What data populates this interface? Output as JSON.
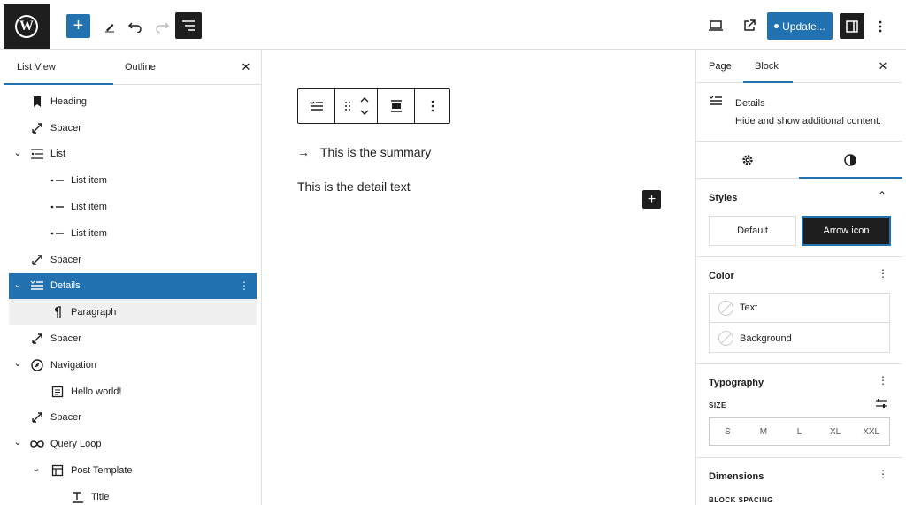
{
  "topbar": {
    "logo_letter": "W",
    "update_label": "Update..."
  },
  "left_panel": {
    "tabs": [
      "List View",
      "Outline"
    ],
    "items": [
      {
        "label": "Heading",
        "icon": "bookmark-icon",
        "chevron": false,
        "level": 1,
        "state": "normal"
      },
      {
        "label": "Spacer",
        "icon": "resize-arrow-icon",
        "chevron": false,
        "level": 1,
        "state": "normal"
      },
      {
        "label": "List",
        "icon": "list-icon",
        "chevron": true,
        "level": 1,
        "state": "normal"
      },
      {
        "label": "List item",
        "icon": "list-item-icon",
        "chevron": false,
        "level": 2,
        "state": "normal"
      },
      {
        "label": "List item",
        "icon": "list-item-icon",
        "chevron": false,
        "level": 2,
        "state": "normal"
      },
      {
        "label": "List item",
        "icon": "list-item-icon",
        "chevron": false,
        "level": 2,
        "state": "normal"
      },
      {
        "label": "Spacer",
        "icon": "resize-arrow-icon",
        "chevron": false,
        "level": 1,
        "state": "normal"
      },
      {
        "label": "Details",
        "icon": "details-icon",
        "chevron": true,
        "level": 1,
        "state": "selected"
      },
      {
        "label": "Paragraph",
        "icon": "pilcrow-icon",
        "chevron": false,
        "level": 2,
        "state": "child"
      },
      {
        "label": "Spacer",
        "icon": "resize-arrow-icon",
        "chevron": false,
        "level": 1,
        "state": "normal"
      },
      {
        "label": "Navigation",
        "icon": "compass-icon",
        "chevron": true,
        "level": 1,
        "state": "normal"
      },
      {
        "label": "Hello world!",
        "icon": "page-icon",
        "chevron": false,
        "level": 2,
        "state": "normal"
      },
      {
        "label": "Spacer",
        "icon": "resize-arrow-icon",
        "chevron": false,
        "level": 1,
        "state": "normal"
      },
      {
        "label": "Query Loop",
        "icon": "loop-icon",
        "chevron": true,
        "level": 1,
        "state": "normal"
      },
      {
        "label": "Post Template",
        "icon": "layout-icon",
        "chevron": true,
        "level": 2,
        "state": "normal"
      },
      {
        "label": "Title",
        "icon": "title-icon",
        "chevron": false,
        "level": 3,
        "state": "normal"
      }
    ]
  },
  "editor": {
    "summary_text": "This is the summary",
    "detail_text": "This is the detail text"
  },
  "right_panel": {
    "tabs": [
      "Page",
      "Block"
    ],
    "block_title": "Details",
    "block_desc": "Hide and show additional content.",
    "styles": {
      "heading": "Styles",
      "default_label": "Default",
      "arrow_label": "Arrow icon"
    },
    "color": {
      "heading": "Color",
      "text_label": "Text",
      "background_label": "Background"
    },
    "typography": {
      "heading": "Typography",
      "size_label": "SIZE",
      "sizes": [
        "S",
        "M",
        "L",
        "XL",
        "XXL"
      ]
    },
    "dimensions": {
      "heading": "Dimensions",
      "block_spacing_label": "BLOCK SPACING"
    }
  },
  "colors": {
    "accent": "#2271b1",
    "dark": "#1e1e1e"
  }
}
